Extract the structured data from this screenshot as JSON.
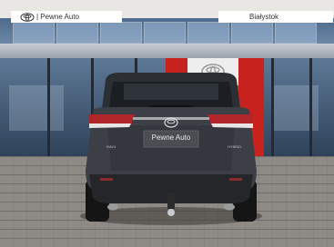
{
  "header_left": {
    "logo": "toyota-logo",
    "dealer_label": "| Pewne Auto"
  },
  "header_right": {
    "city_label": "Białystok"
  },
  "vehicle": {
    "plate_text": "Pewne Auto",
    "rear_badge_left": "RAV4",
    "rear_badge_right": "HYBRID",
    "emblem": "toyota-emblem"
  },
  "colors": {
    "dealer_red": "#c8221f",
    "car_body": "#3c3f45",
    "taillight": "#b0262a"
  }
}
